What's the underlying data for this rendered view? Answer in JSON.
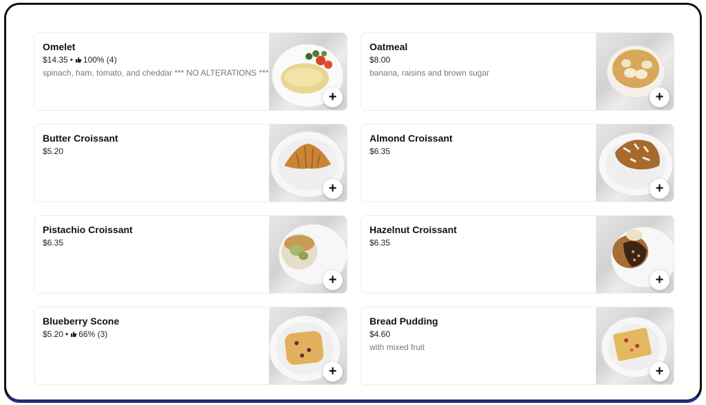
{
  "menu": {
    "items": [
      {
        "name": "Omelet",
        "price": "$14.35",
        "rating": "100% (4)",
        "description": "spinach, ham, tomato, and cheddar *** NO ALTERATIONS ***"
      },
      {
        "name": "Oatmeal",
        "price": "$8.00",
        "rating": "",
        "description": "banana, raisins and brown sugar"
      },
      {
        "name": "Butter Croissant",
        "price": "$5.20",
        "rating": "",
        "description": ""
      },
      {
        "name": "Almond Croissant",
        "price": "$6.35",
        "rating": "",
        "description": ""
      },
      {
        "name": "Pistachio Croissant",
        "price": "$6.35",
        "rating": "",
        "description": ""
      },
      {
        "name": "Hazelnut Croissant",
        "price": "$6.35",
        "rating": "",
        "description": ""
      },
      {
        "name": "Blueberry Scone",
        "price": "$5.20",
        "rating": "66% (3)",
        "description": ""
      },
      {
        "name": "Bread Pudding",
        "price": "$4.60",
        "rating": "",
        "description": "with mixed fruit"
      }
    ],
    "add_label": "+",
    "rating_separator": "•",
    "icons": {
      "rating": "thumbs-up-icon",
      "add": "plus-icon"
    }
  }
}
